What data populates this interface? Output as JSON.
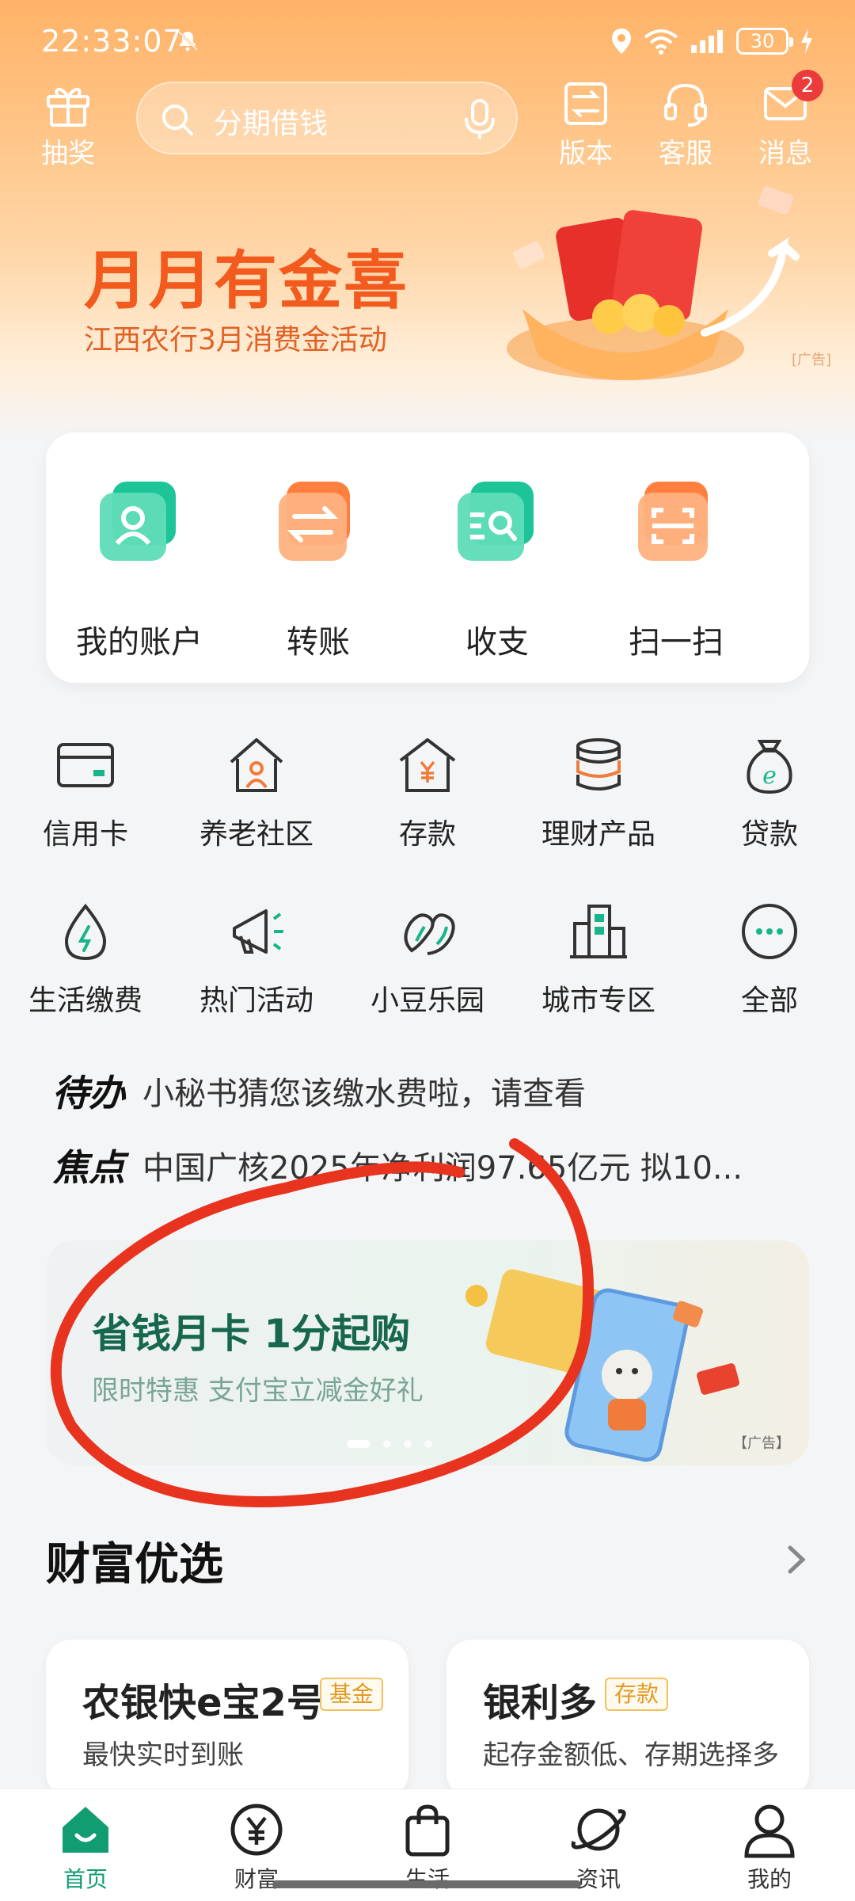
{
  "status_bar": {
    "time": "22:33:07",
    "battery": "30"
  },
  "header": {
    "lottery_label": "抽奖",
    "search_placeholder": "分期借钱",
    "version_label": "版本",
    "service_label": "客服",
    "message_label": "消息",
    "message_badge": "2"
  },
  "banner": {
    "title": "月月有金喜",
    "subtitle": "江西农行3月消费金活动",
    "ad_label": "[广告]"
  },
  "quick_actions": [
    {
      "label": "我的账户",
      "icon": "account-icon"
    },
    {
      "label": "转账",
      "icon": "transfer-icon"
    },
    {
      "label": "收支",
      "icon": "income-expense-icon"
    },
    {
      "label": "扫一扫",
      "icon": "scan-icon"
    }
  ],
  "services_row1": [
    {
      "label": "信用卡",
      "icon": "credit-card-icon"
    },
    {
      "label": "养老社区",
      "icon": "elderly-community-icon"
    },
    {
      "label": "存款",
      "icon": "deposit-icon"
    },
    {
      "label": "理财产品",
      "icon": "wealth-products-icon"
    },
    {
      "label": "贷款",
      "icon": "loan-icon"
    }
  ],
  "services_row2": [
    {
      "label": "生活缴费",
      "icon": "utility-payment-icon"
    },
    {
      "label": "热门活动",
      "icon": "hot-events-icon"
    },
    {
      "label": "小豆乐园",
      "icon": "kids-park-icon"
    },
    {
      "label": "城市专区",
      "icon": "city-zone-icon"
    },
    {
      "label": "全部",
      "icon": "more-icon"
    }
  ],
  "notices": {
    "todo_tag": "待办",
    "todo_text": "小秘书猜您该缴水费啦，请查看",
    "focus_tag": "焦点",
    "focus_text": "中国广核2025年净利润97.65亿元 拟10..."
  },
  "ad_banner": {
    "title": "省钱月卡 1分起购",
    "subtitle": "限时特惠 支付宝立减金好礼",
    "ad_label": "【广告】"
  },
  "wealth": {
    "section_title": "财富优选",
    "cards": [
      {
        "name": "农银快e宝2号",
        "tag": "基金",
        "desc": "最快实时到账"
      },
      {
        "name": "银利多",
        "tag": "存款",
        "desc": "起存金额低、存期选择多"
      }
    ]
  },
  "bottom_nav": [
    {
      "label": "首页",
      "active": true
    },
    {
      "label": "财富",
      "active": false
    },
    {
      "label": "生活",
      "active": false
    },
    {
      "label": "资讯",
      "active": false
    },
    {
      "label": "我的",
      "active": false
    }
  ],
  "colors": {
    "brand_green": "#119c72",
    "banner_orange": "#f25a1e",
    "annotation_red": "#e8331f"
  }
}
